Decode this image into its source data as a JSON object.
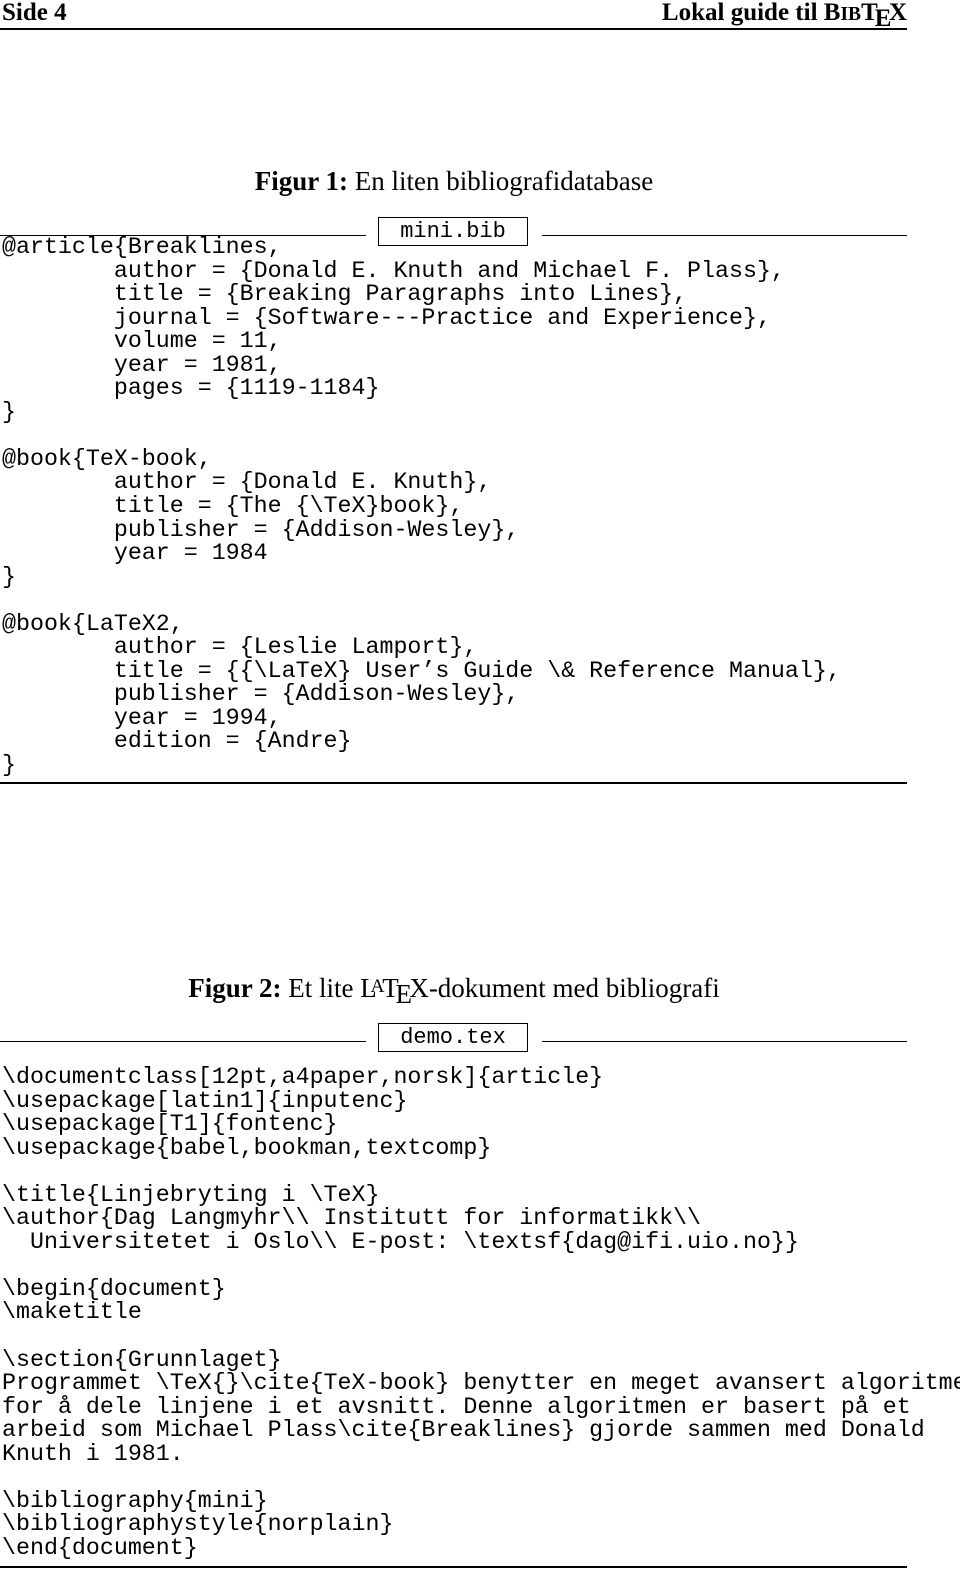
{
  "header": {
    "page": "Side 4",
    "title_prefix": "Lokal guide til ",
    "title_logo": "BibTeX"
  },
  "figure1": {
    "label": "Figur 1:",
    "caption": "En liten bibliografidatabase",
    "filename": "mini.bib",
    "lines": [
      "@article{Breaklines,",
      "        author = {Donald E. Knuth and Michael F. Plass},",
      "        title = {Breaking Paragraphs into Lines},",
      "        journal = {Software---Practice and Experience},",
      "        volume = 11,",
      "        year = 1981,",
      "        pages = {1119-1184}",
      "}",
      "",
      "@book{TeX-book,",
      "        author = {Donald E. Knuth},",
      "        title = {The {\\TeX}book},",
      "        publisher = {Addison-Wesley},",
      "        year = 1984",
      "}",
      "",
      "@book{LaTeX2,",
      "        author = {Leslie Lamport},",
      "        title = {{\\LaTeX} User’s Guide \\& Reference Manual},",
      "        publisher = {Addison-Wesley},",
      "        year = 1994,",
      "        edition = {Andre}",
      "}"
    ]
  },
  "figure2": {
    "label": "Figur 2:",
    "caption_before": "Et lite ",
    "caption_logo": "LaTeX",
    "caption_after": "-dokument med bibliografi",
    "filename": "demo.tex",
    "lines": [
      "\\documentclass[12pt,a4paper,norsk]{article}",
      "\\usepackage[latin1]{inputenc}",
      "\\usepackage[T1]{fontenc}",
      "\\usepackage{babel,bookman,textcomp}",
      "",
      "\\title{Linjebryting i \\TeX}",
      "\\author{Dag Langmyhr\\\\ Institutt for informatikk\\\\",
      "  Universitetet i Oslo\\\\ E-post: \\textsf{dag@ifi.uio.no}}",
      "",
      "\\begin{document}",
      "\\maketitle",
      "",
      "\\section{Grunnlaget}",
      "Programmet \\TeX{}\\cite{TeX-book} benytter en meget avansert algoritme",
      "for å dele linjene i et avsnitt. Denne algoritmen er basert på et",
      "arbeid som Michael Plass\\cite{Breaklines} gjorde sammen med Donald",
      "Knuth i 1981.",
      "",
      "\\bibliography{mini}",
      "\\bibliographystyle{norplain}",
      "\\end{document}"
    ]
  }
}
